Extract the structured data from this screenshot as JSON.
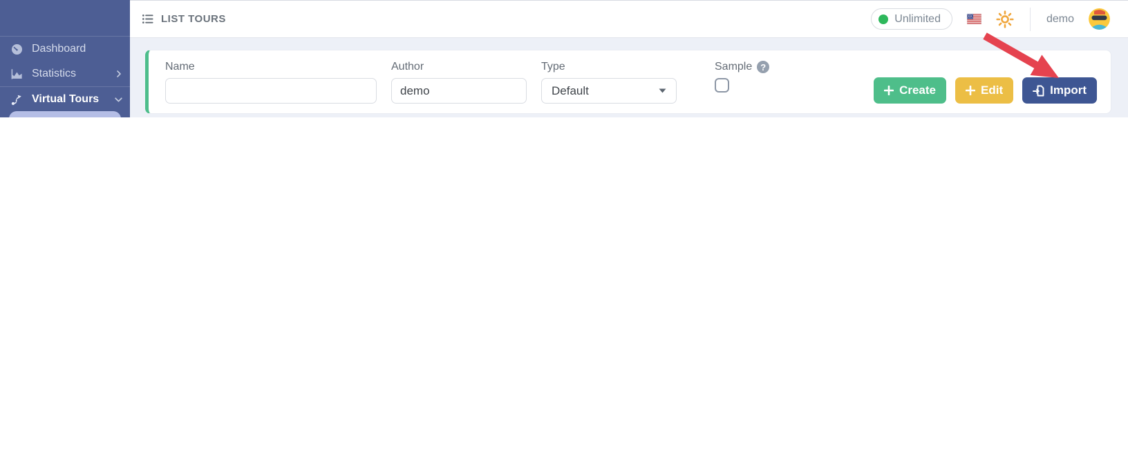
{
  "topbar": {
    "title": "LIST TOURS",
    "plan_badge": "Unlimited",
    "username": "demo"
  },
  "sidebar": {
    "items": [
      {
        "label": "Dashboard"
      },
      {
        "label": "Statistics"
      },
      {
        "label": "Virtual Tours"
      }
    ]
  },
  "filters": {
    "name_label": "Name",
    "name_value": "",
    "author_label": "Author",
    "author_value": "demo",
    "type_label": "Type",
    "type_value": "Default",
    "sample_label": "Sample"
  },
  "actions": {
    "create": "Create",
    "edit": "Edit",
    "import": "Import"
  },
  "icons": {
    "help_glyph": "?"
  },
  "colors": {
    "sidebar_bg": "#4d5e94",
    "card_edge_green": "#4dbd8b",
    "button_create": "#4ebe8a",
    "button_edit": "#ecbe45",
    "button_import": "#3e5693",
    "badge_dot_green": "#2eb85c",
    "sun_orange": "#f0a63c",
    "arrow_red": "#e5434f",
    "main_bg": "#edf0f7"
  }
}
